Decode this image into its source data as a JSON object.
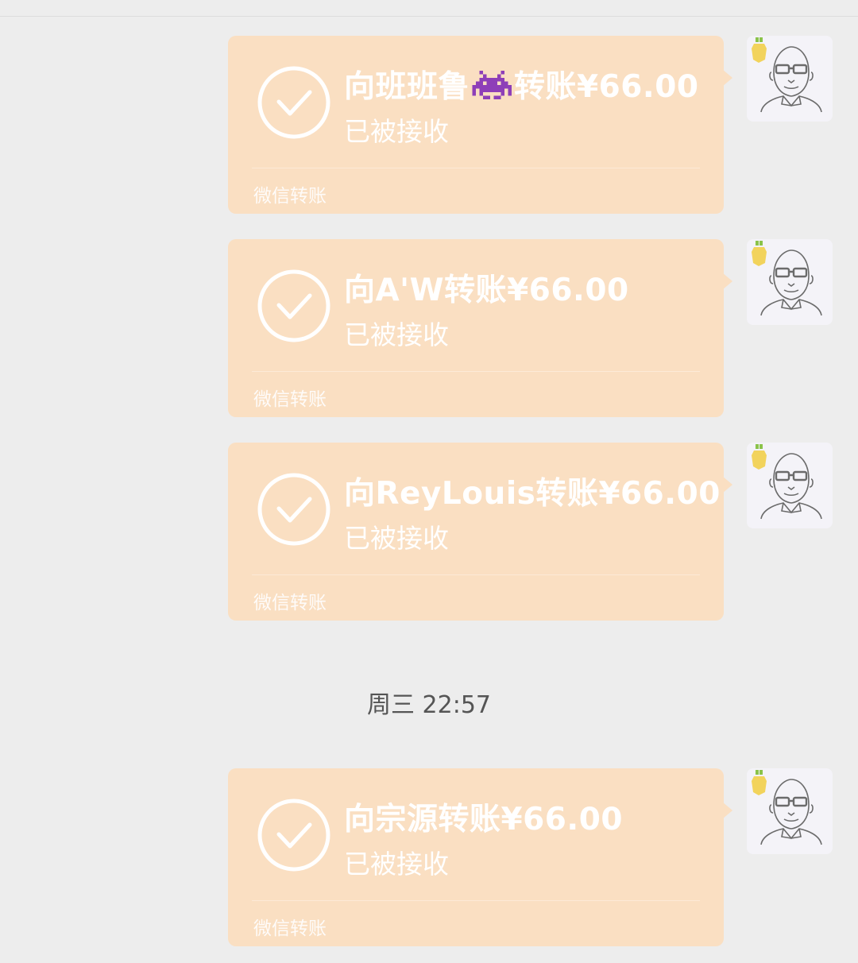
{
  "messages": [
    {
      "title_prefix": "向班班鲁",
      "emoji": "space-invader-emoji",
      "title_suffix": "转账¥66.00",
      "status": "已被接收",
      "footer": "微信转账"
    },
    {
      "title": "向A'W转账¥66.00",
      "status": "已被接收",
      "footer": "微信转账"
    },
    {
      "title": "向ReyLouis转账¥66.00",
      "status": "已被接收",
      "footer": "微信转账"
    },
    {
      "title": "向宗源转账¥66.00",
      "status": "已被接收",
      "footer": "微信转账"
    }
  ],
  "timestamp": "周三 22:57",
  "colors": {
    "bubble": "#fadfc2",
    "background": "#ededed",
    "emoji": "#8e3fb8",
    "avatar_badge": "#f2d35c"
  },
  "icons": {
    "status": "check-circle-icon",
    "avatar": "user-avatar-bald-glasses",
    "emoji": "space-invader-emoji"
  }
}
